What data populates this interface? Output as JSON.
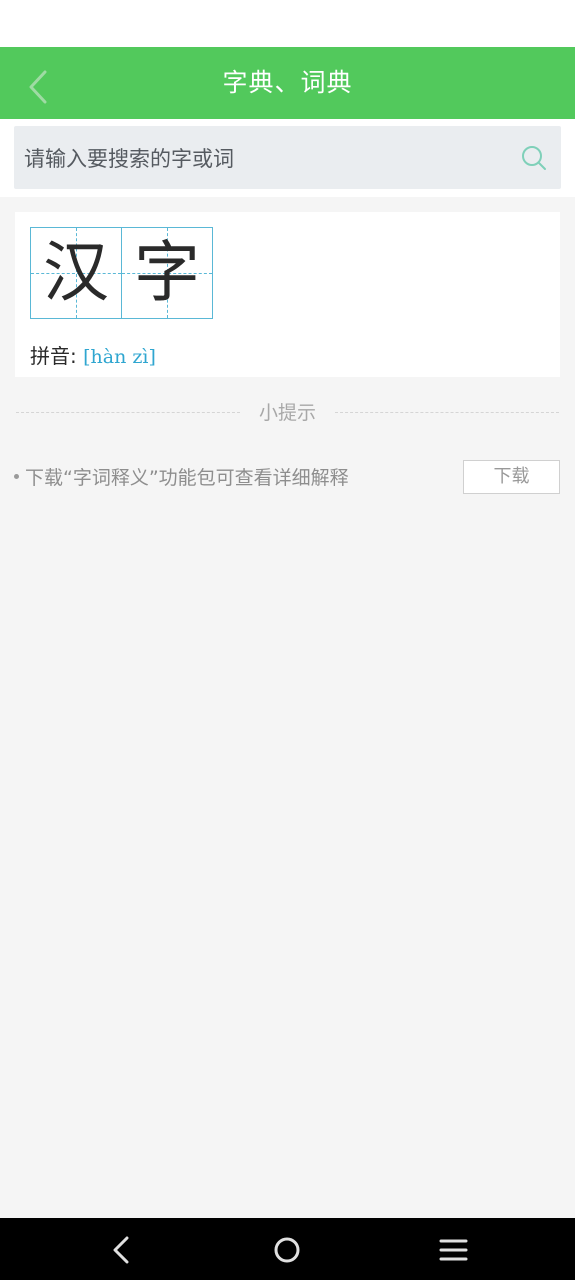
{
  "colors": {
    "accent": "#52c95c",
    "link": "#2fa6d0"
  },
  "header": {
    "title": "字典、词典",
    "back_icon": "chevron-left-icon"
  },
  "search": {
    "placeholder": "请输入要搜索的字或词",
    "value": "",
    "icon": "search-icon"
  },
  "result": {
    "characters": [
      "汉",
      "字"
    ],
    "pinyin_label": "拼音:",
    "pinyin": "[hàn zì]"
  },
  "tips": {
    "heading": "小提示",
    "items": [
      {
        "text": "下载“字词释义”功能包可查看详细解释",
        "button": "下载"
      }
    ]
  },
  "nav": {
    "back_icon": "nav-back-icon",
    "home_icon": "nav-home-icon",
    "menu_icon": "nav-menu-icon"
  }
}
